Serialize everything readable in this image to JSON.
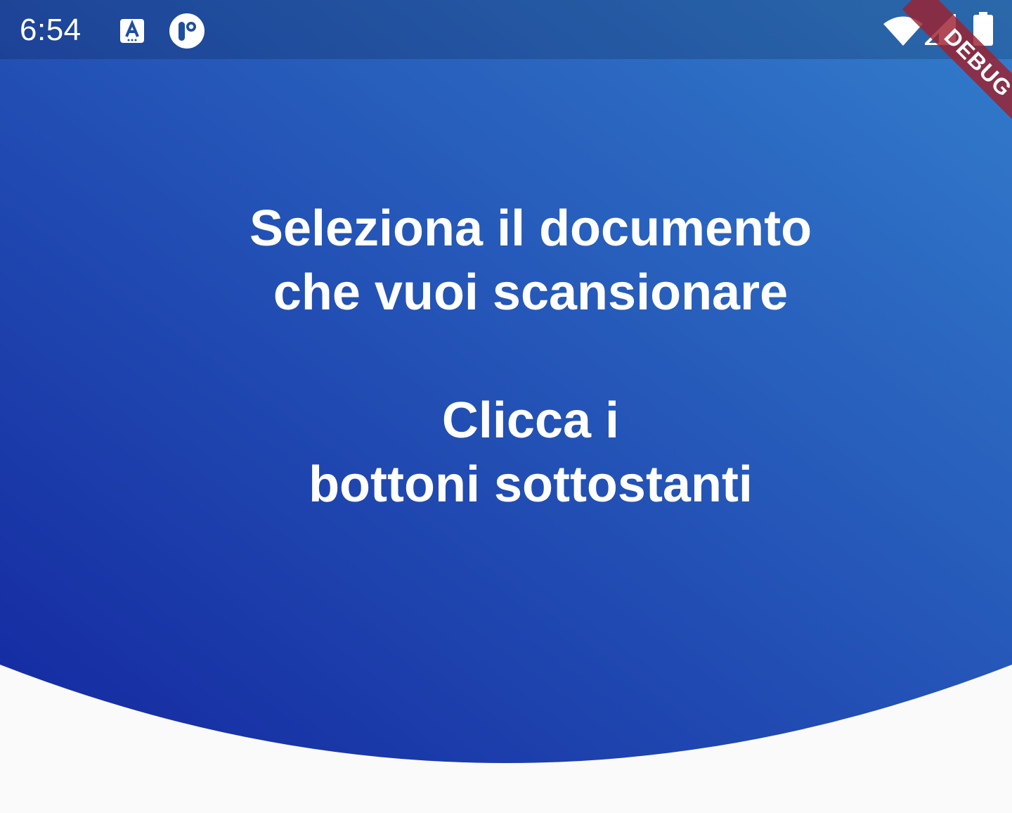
{
  "status_bar": {
    "time": "6:54",
    "left_icons": [
      "text-accessibility-icon",
      "app-notification-icon"
    ],
    "right_icons": [
      "wifi-icon",
      "cellular-signal-icon",
      "battery-icon"
    ]
  },
  "main": {
    "line_1": "Seleziona il documento",
    "line_2": "che vuoi scansionare",
    "line_3": "Clicca i",
    "line_4": "bottoni sottostanti"
  },
  "debug_banner": {
    "label": "DEBUG",
    "color": "#9e2130"
  },
  "colors": {
    "gradient_start": "#1428a0",
    "gradient_end": "#337dcc",
    "text": "#ffffff",
    "background": "#fafafa"
  }
}
